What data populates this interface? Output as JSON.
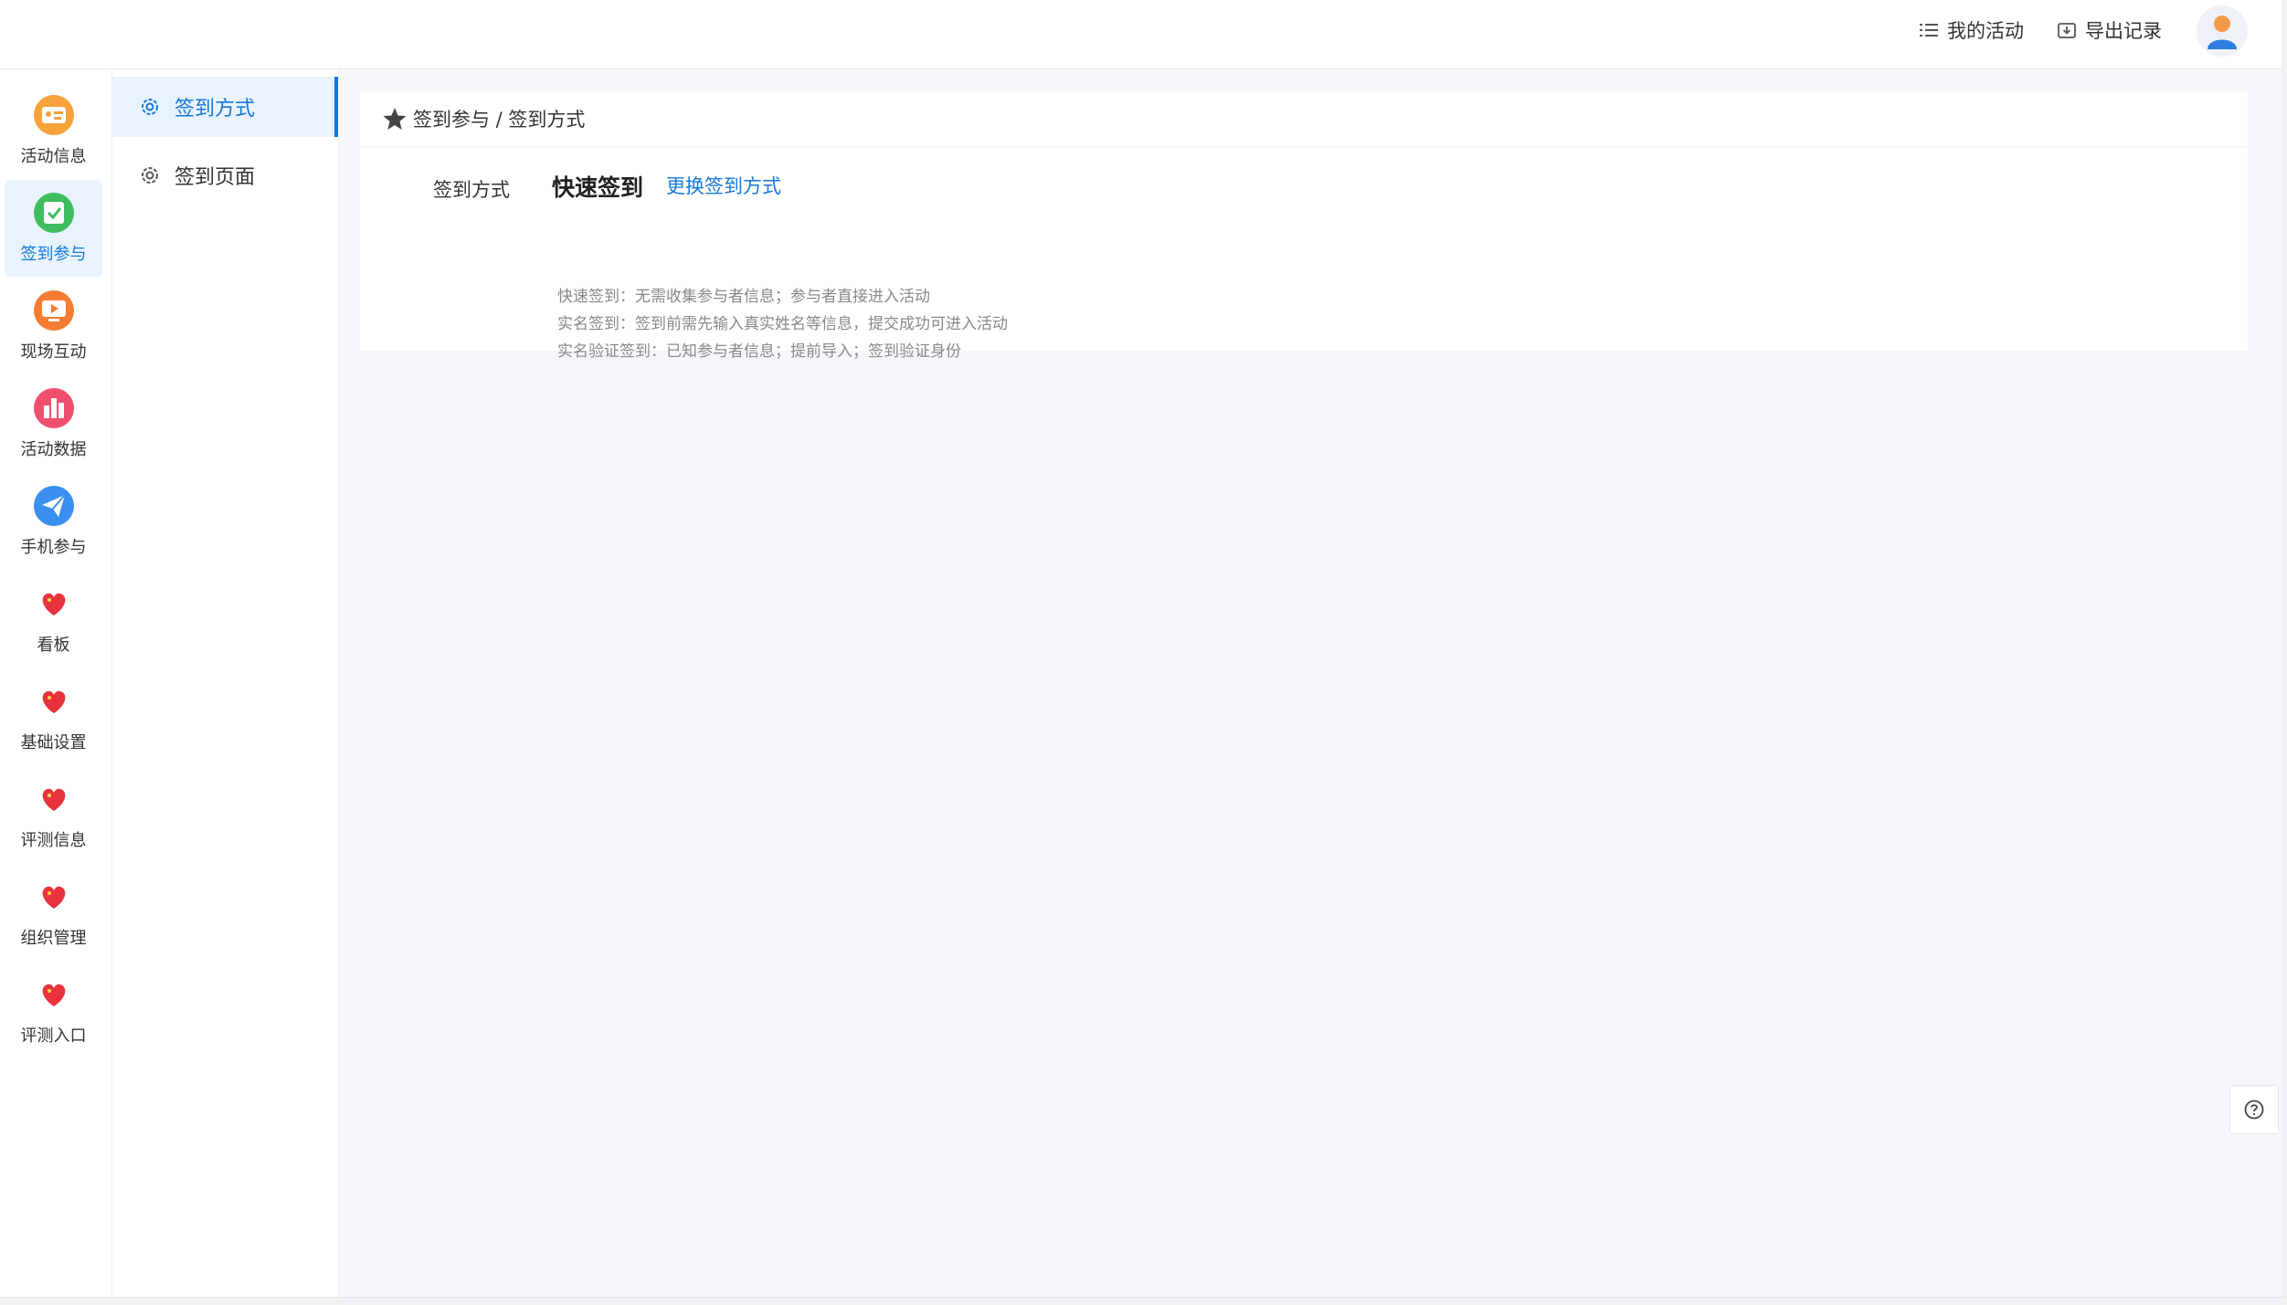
{
  "header": {
    "my_activities": "我的活动",
    "export_records": "导出记录"
  },
  "rail": {
    "items": [
      {
        "label": "活动信息",
        "icon": "id-card-icon"
      },
      {
        "label": "签到参与",
        "icon": "checkin-icon",
        "active": true
      },
      {
        "label": "现场互动",
        "icon": "screen-play-icon"
      },
      {
        "label": "活动数据",
        "icon": "bar-chart-icon"
      },
      {
        "label": "手机参与",
        "icon": "paper-plane-icon"
      },
      {
        "label": "看板",
        "icon": "heart-icon"
      },
      {
        "label": "基础设置",
        "icon": "heart-icon"
      },
      {
        "label": "评测信息",
        "icon": "heart-icon"
      },
      {
        "label": "组织管理",
        "icon": "heart-icon"
      },
      {
        "label": "评测入口",
        "icon": "heart-icon"
      }
    ]
  },
  "submenu": {
    "items": [
      {
        "label": "签到方式",
        "active": true
      },
      {
        "label": "签到页面"
      }
    ]
  },
  "breadcrumb": "签到参与 / 签到方式",
  "form": {
    "label": "签到方式",
    "value": "快速签到",
    "change_link": "更换签到方式",
    "descriptions": [
      "快速签到：无需收集参与者信息；参与者直接进入活动",
      "实名签到：签到前需先输入真实姓名等信息，提交成功可进入活动",
      "实名验证签到：已知参与者信息；提前导入；签到验证身份"
    ]
  },
  "colors": {
    "primary": "#1677d9",
    "active_bg": "#e8f3fd",
    "main_bg": "#f5f7fa"
  }
}
